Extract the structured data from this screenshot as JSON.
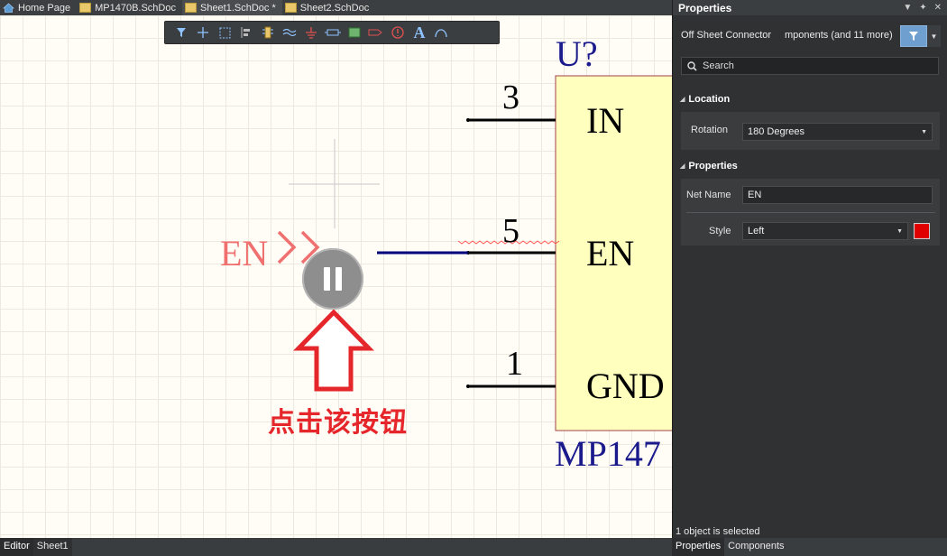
{
  "tabs": [
    {
      "label": "Home Page",
      "icon": "home-icon"
    },
    {
      "label": "MP1470B.SchDoc",
      "icon": "schdoc-icon"
    },
    {
      "label": "Sheet1.SchDoc *",
      "icon": "schdoc-icon",
      "active": true
    },
    {
      "label": "Sheet2.SchDoc",
      "icon": "schdoc-icon"
    }
  ],
  "toolbar": {
    "icons": [
      "filter-icon",
      "crosshair-icon",
      "select-rect-icon",
      "align-icon",
      "component-icon",
      "wire-icon",
      "ground-icon",
      "resistor-icon",
      "sheet-symbol-icon",
      "port-icon",
      "no-erc-icon",
      "text-icon",
      "arc-icon"
    ]
  },
  "schematic": {
    "designator": "U?",
    "part_name": "MP147",
    "pins": [
      {
        "number": "3",
        "name": "IN"
      },
      {
        "number": "5",
        "name": "EN"
      },
      {
        "number": "1",
        "name": "GND"
      }
    ],
    "connector_label": "EN"
  },
  "overlay": {
    "hint": "点击该按钮"
  },
  "panel": {
    "title": "Properties",
    "filter_label": "Off Sheet Connector",
    "filter_scope": "mponents (and 11 more)",
    "search_placeholder": "Search",
    "location_header": "Location",
    "rotation_label": "Rotation",
    "rotation_value": "180 Degrees",
    "properties_header": "Properties",
    "net_name_label": "Net Name",
    "net_name_value": "EN",
    "style_label": "Style",
    "style_value": "Left",
    "style_color": "#e00000",
    "status": "1 object is selected"
  },
  "bottom_tabs_left": [
    "Editor",
    "Sheet1"
  ],
  "bottom_tabs_right": [
    "Properties",
    "Components"
  ],
  "colors": {
    "canvas": "#fffdf6",
    "component_fill": "#ffffbe",
    "component_border": "#a0404a",
    "designator": "#1a1a8c",
    "wire": "#00007a",
    "connector": "#f07070",
    "accent": "#6f9fcf"
  }
}
